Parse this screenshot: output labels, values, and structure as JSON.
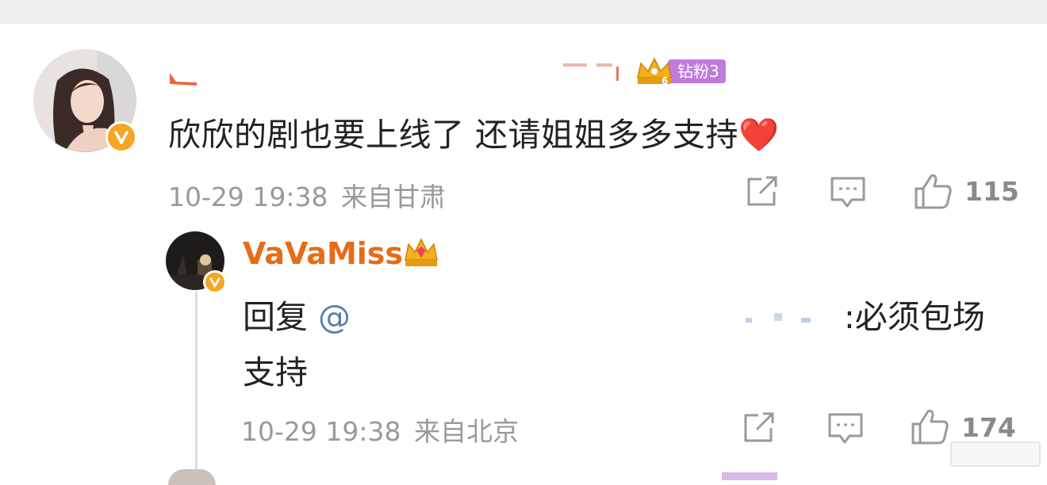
{
  "comment": {
    "user_name": "",
    "fan_badge": {
      "label": "钻粉3",
      "level": "6",
      "icon": "crown-icon"
    },
    "text": "欣欣的剧也要上线了 还请姐姐多多支持",
    "emoji": "❤️",
    "timestamp": "10-29 19:38",
    "location": "来自甘肃",
    "like_count": "115",
    "verified_icon": "verified-v-icon"
  },
  "reply": {
    "user_name": "VaVaMiss",
    "name_icon": "crown-icon",
    "prefix": "回复",
    "mention": "@",
    "text_line1": ":必须包场",
    "text_line2": "支持",
    "timestamp": "10-29 19:38",
    "location": "来自北京",
    "like_count": "174",
    "verified_icon": "verified-v-icon"
  },
  "colors": {
    "name_orange": "#e86b16",
    "meta_gray": "#999999",
    "fan_purple": "#c17bdc",
    "verified_gold": "#f5a623",
    "mention_blue": "#5b7fb3"
  },
  "icons": [
    "share-icon",
    "comment-icon",
    "like-thumb-icon"
  ]
}
